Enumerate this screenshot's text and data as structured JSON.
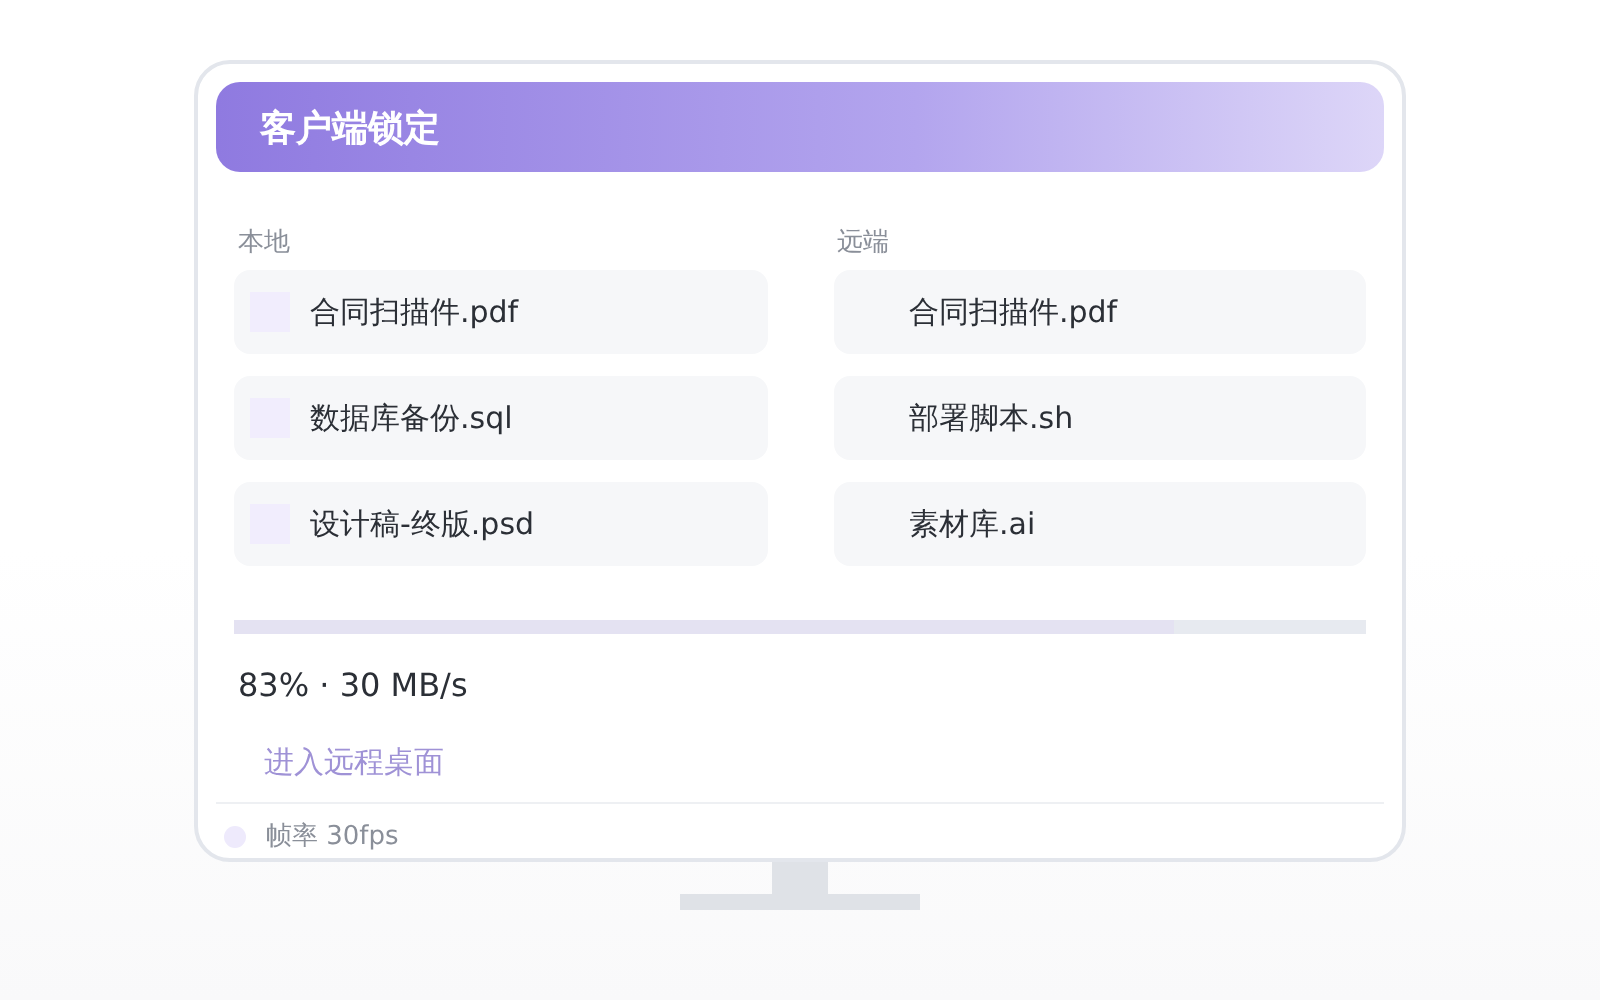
{
  "header": {
    "title": "客户端锁定"
  },
  "local": {
    "label": "本地",
    "files": [
      {
        "name": "合同扫描件.pdf"
      },
      {
        "name": "数据库备份.sql"
      },
      {
        "name": "设计稿-终版.psd"
      }
    ]
  },
  "remote": {
    "label": "远端",
    "files": [
      {
        "name": "合同扫描件.pdf"
      },
      {
        "name": "部署脚本.sh"
      },
      {
        "name": "素材库.ai"
      }
    ]
  },
  "transfer": {
    "level": 0.83,
    "reading": "83% · 30 MB/s"
  },
  "action": {
    "label": "进入远程桌面",
    "disabled": true
  },
  "status": {
    "text": "帧率 30fps",
    "color": "#eeeafc"
  }
}
